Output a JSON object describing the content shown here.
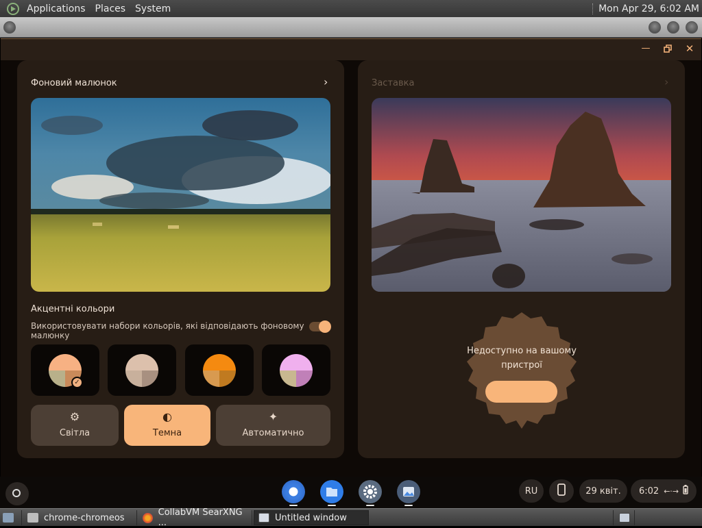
{
  "top_panel": {
    "menu": [
      "Applications",
      "Places",
      "System"
    ],
    "clock": "Mon Apr 29,  6:02 AM"
  },
  "wallpaper_card": {
    "title": "Фоновий малюнок",
    "accent_title": "Акцентні кольори",
    "accent_toggle_label": "Використовувати набори кольорів, які відповідають фоновому малюнку",
    "accent_toggle_on": true,
    "modes": [
      {
        "label": "Світла",
        "icon": "gear-icon"
      },
      {
        "label": "Темна",
        "icon": "half-circle-icon"
      },
      {
        "label": "Автоматично",
        "icon": "magic-wand-icon"
      }
    ],
    "active_mode": "Темна"
  },
  "screensaver_card": {
    "title": "Заставка",
    "unavailable_text": "Недоступно на вашому пристрої"
  },
  "shelf": {
    "apps": [
      "Chrome",
      "Files",
      "Settings",
      "Gallery"
    ],
    "input_method": "RU",
    "date": "29 квіт.",
    "time": "6:02"
  },
  "taskbar": {
    "tasks": [
      "chrome-chromeos",
      "CollabVM SearXNG ...",
      "Untitled window"
    ],
    "active_task": "Untitled window"
  },
  "colors": {
    "accent": "#f8b57a",
    "card_bg": "#271d15",
    "window_bg": "#0e0906"
  }
}
